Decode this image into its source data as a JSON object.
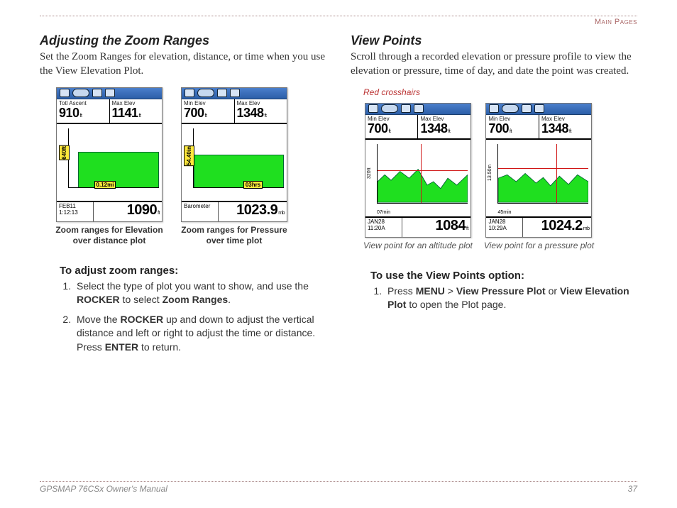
{
  "header": {
    "section": "Main Pages"
  },
  "left": {
    "title": "Adjusting the Zoom Ranges",
    "intro": "Set the Zoom Ranges for elevation, distance, or time when you use the View Elevation Plot.",
    "dev1": {
      "stat1_label": "Totl Ascent",
      "stat1_val": "910",
      "stat1_unit": "ft",
      "stat2_label": "Max Elev",
      "stat2_val": "1141",
      "stat2_unit": "ft",
      "zoom_v": "640ft",
      "zoom_h": "0.12mi",
      "bottom_left": "FEB11\n1:12:13",
      "bottom_val": "1090",
      "bottom_unit": "ft",
      "caption": "Zoom ranges for Elevation over distance plot"
    },
    "dev2": {
      "stat1_label": "Min Elev",
      "stat1_val": "700",
      "stat1_unit": "ft",
      "stat2_label": "Max Elev",
      "stat2_val": "1348",
      "stat2_unit": "ft",
      "zoom_v": "54.40in",
      "zoom_h": "03hrs",
      "bottom_left": "Barometer",
      "bottom_val": "1023.9",
      "bottom_unit": "mb",
      "caption": "Zoom ranges for Pressure over time plot"
    },
    "instr_title": "To adjust zoom ranges:",
    "step1a": "Select the type of plot you want to show, and use the ",
    "step1b": "ROCKER",
    "step1c": " to select ",
    "step1d": "Zoom Ranges",
    "step1e": ".",
    "step2a": "Move the ",
    "step2b": "ROCKER",
    "step2c": " up and down to adjust the vertical distance and left or right to adjust the time or distance. Press ",
    "step2d": "ENTER",
    "step2e": " to return."
  },
  "right": {
    "title": "View Points",
    "intro": "Scroll through a recorded elevation or pressure profile to view the elevation or pressure, time of day, and date the point was created.",
    "red_label": "Red crosshairs",
    "dev1": {
      "stat1_label": "Min Elev",
      "stat1_val": "700",
      "stat1_unit": "ft",
      "stat2_label": "Max Elev",
      "stat2_val": "1348",
      "stat2_unit": "ft",
      "vscale": "320ft",
      "hscale": "07min",
      "bottom_left": "JAN28\n11:20A",
      "bottom_val": "1084",
      "bottom_unit": "ft",
      "caption": "View point for an altitude plot"
    },
    "dev2": {
      "stat1_label": "Min Elev",
      "stat1_val": "700",
      "stat1_unit": "ft",
      "stat2_label": "Max Elev",
      "stat2_val": "1348",
      "stat2_unit": "ft",
      "vscale": "13.50in",
      "hscale": "45min",
      "bottom_left": "JAN28\n10:29A",
      "bottom_val": "1024.2",
      "bottom_unit": "mb",
      "caption": "View point for a pressure plot"
    },
    "instr_title": "To use the View Points option:",
    "step1a": "Press ",
    "step1b": "MENU",
    "step1c": " > ",
    "step1d": "View Pressure Plot",
    "step1e": " or ",
    "step1f": "View Elevation Plot",
    "step1g": " to open the Plot page."
  },
  "footer": {
    "left": "GPSMAP 76CSx Owner's Manual",
    "right": "37"
  },
  "chart_data": [
    {
      "type": "area",
      "title": "Elevation over distance (zoom)",
      "stats": {
        "Totl Ascent": 910,
        "Max Elev": 1141
      },
      "current_elev_ft": 1090,
      "zoom": {
        "vertical": "640ft",
        "horizontal": "0.12mi"
      }
    },
    {
      "type": "area",
      "title": "Pressure over time (zoom)",
      "stats": {
        "Min Elev": 700,
        "Max Elev": 1348
      },
      "barometer_mb": 1023.9,
      "zoom": {
        "vertical": "54.40in",
        "horizontal": "03hrs"
      }
    },
    {
      "type": "line",
      "title": "Altitude view point",
      "stats": {
        "Min Elev": 700,
        "Max Elev": 1348
      },
      "crosshair_value_ft": 1084,
      "timestamp": "JAN28 11:20A",
      "scale": {
        "v": "320ft",
        "h": "07min"
      }
    },
    {
      "type": "line",
      "title": "Pressure view point",
      "stats": {
        "Min Elev": 700,
        "Max Elev": 1348
      },
      "crosshair_value_mb": 1024.2,
      "timestamp": "JAN28 10:29A",
      "scale": {
        "v": "13.50in",
        "h": "45min"
      }
    }
  ]
}
